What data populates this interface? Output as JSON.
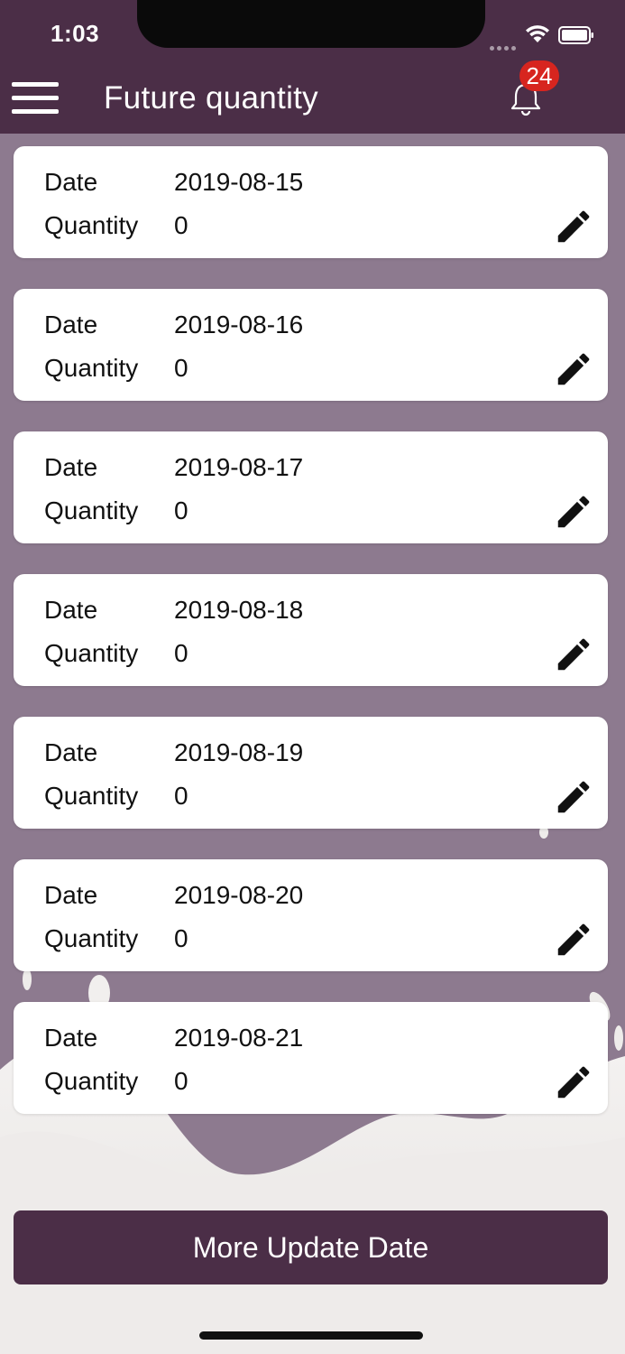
{
  "status_bar": {
    "time": "1:03"
  },
  "header": {
    "title": "Future quantity",
    "notification_count": "24"
  },
  "entries": [
    {
      "date_label": "Date",
      "date": "2019-08-15",
      "quantity_label": "Quantity",
      "quantity": "0"
    },
    {
      "date_label": "Date",
      "date": "2019-08-16",
      "quantity_label": "Quantity",
      "quantity": "0"
    },
    {
      "date_label": "Date",
      "date": "2019-08-17",
      "quantity_label": "Quantity",
      "quantity": "0"
    },
    {
      "date_label": "Date",
      "date": "2019-08-18",
      "quantity_label": "Quantity",
      "quantity": "0"
    },
    {
      "date_label": "Date",
      "date": "2019-08-19",
      "quantity_label": "Quantity",
      "quantity": "0"
    },
    {
      "date_label": "Date",
      "date": "2019-08-20",
      "quantity_label": "Quantity",
      "quantity": "0"
    },
    {
      "date_label": "Date",
      "date": "2019-08-21",
      "quantity_label": "Quantity",
      "quantity": "0"
    }
  ],
  "footer": {
    "button_label": "More Update Date"
  },
  "icons": {
    "menu": "hamburger-menu-icon",
    "notifications": "bell-icon",
    "edit": "pencil-icon",
    "wifi": "wifi-icon",
    "battery": "battery-icon"
  },
  "colors": {
    "primary": "#4b2e47",
    "background": "#8d7a8f",
    "badge": "#d7251f",
    "card": "#ffffff"
  }
}
